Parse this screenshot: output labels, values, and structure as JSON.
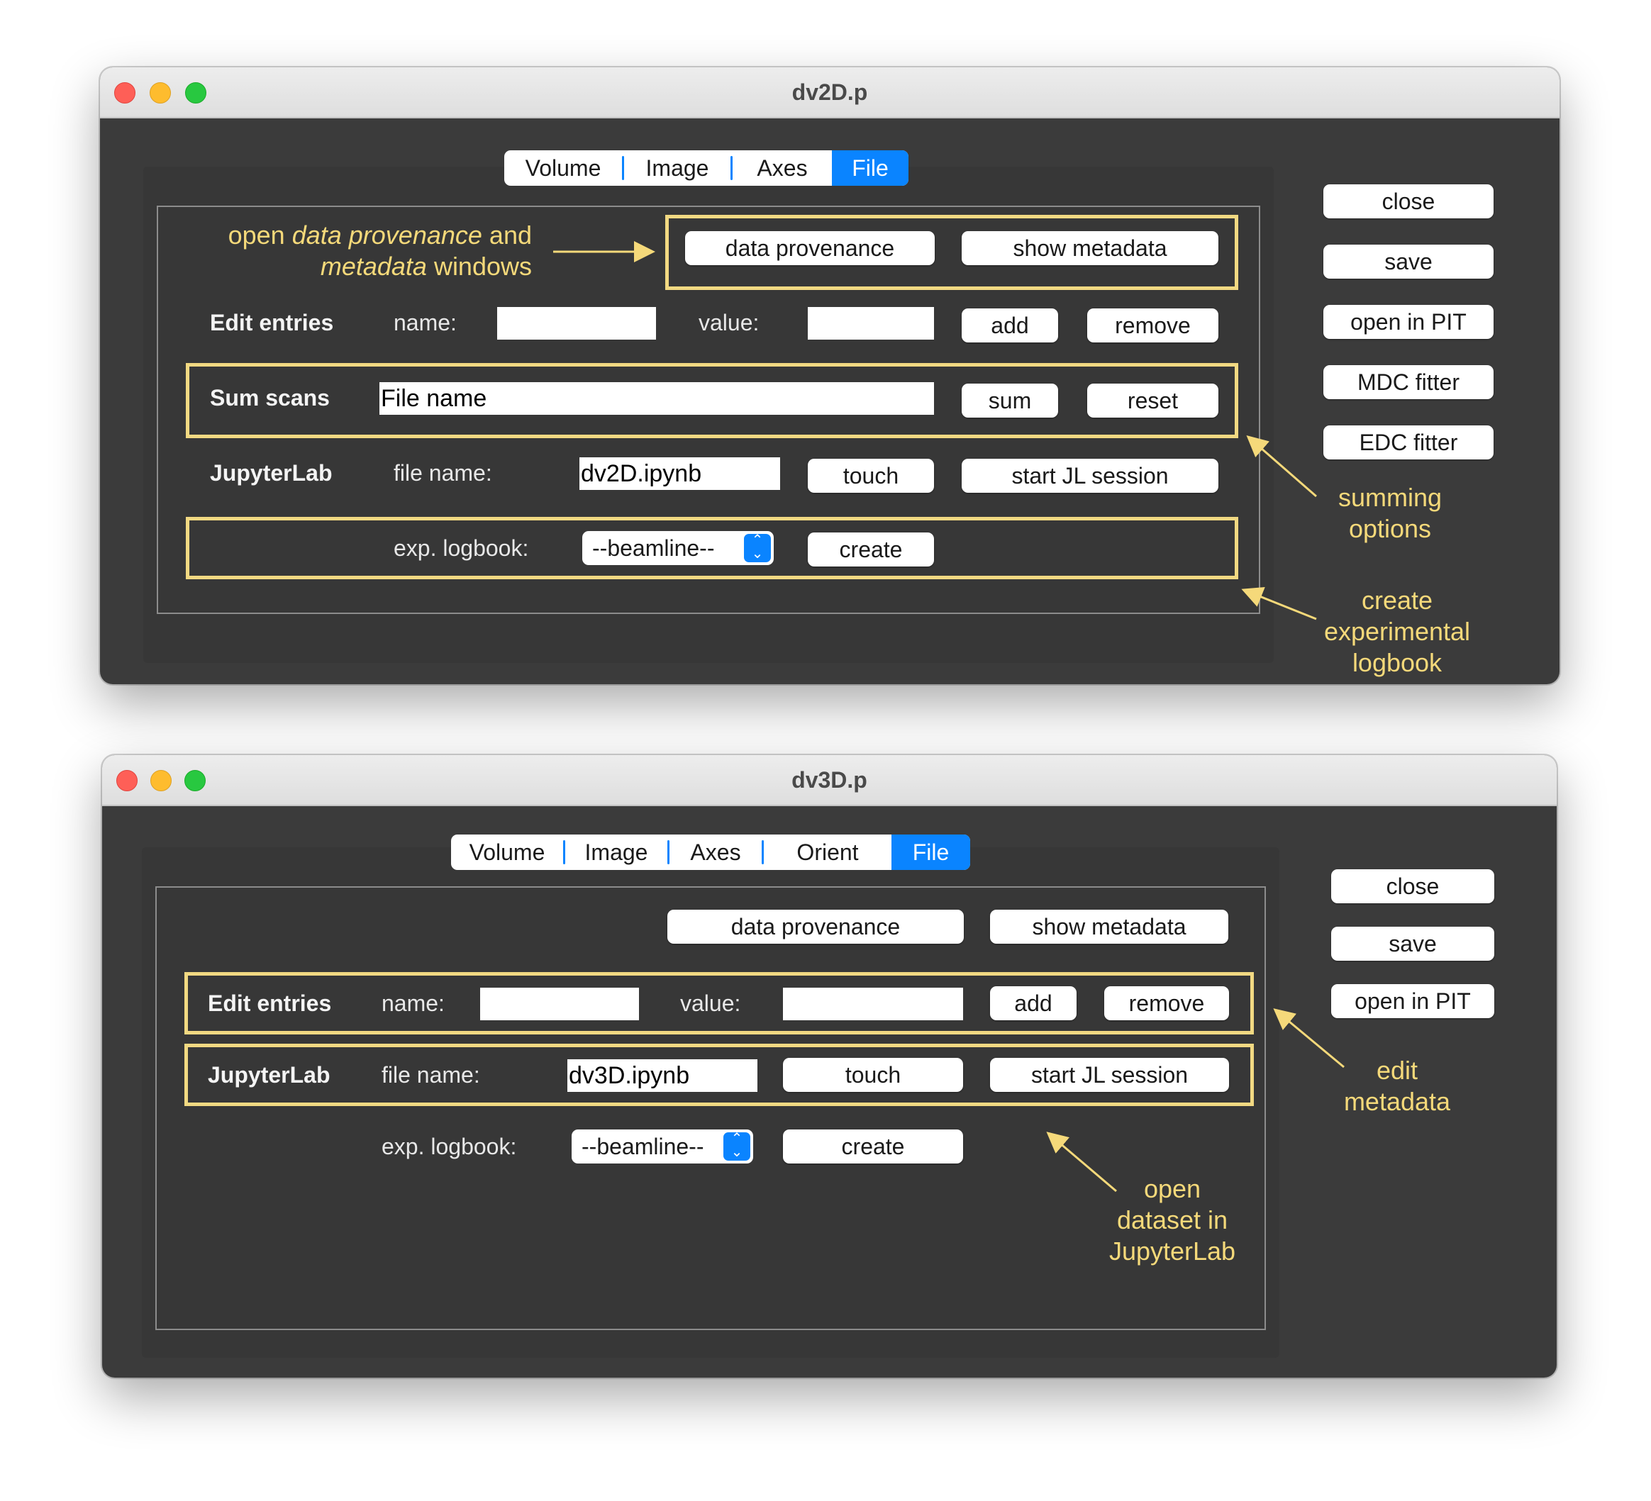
{
  "window1": {
    "title": "dv2D.p",
    "tabs": [
      "Volume",
      "Image",
      "Axes",
      "File"
    ],
    "data_provenance": "data provenance",
    "show_metadata": "show metadata",
    "edit_entries": "Edit entries",
    "name_label": "name:",
    "name_value": "",
    "value_label": "value:",
    "value_value": "",
    "add": "add",
    "remove": "remove",
    "sum_scans": "Sum scans",
    "sum_file_name": "File name",
    "sum": "sum",
    "reset": "reset",
    "jupyterlab": "JupyterLab",
    "file_name_label": "file name:",
    "file_name_value": "dv2D.ipynb",
    "touch": "touch",
    "start_jl": "start JL session",
    "logbook_label": "exp. logbook:",
    "logbook_value": "--beamline--",
    "create": "create",
    "side_buttons": [
      "close",
      "save",
      "open in PIT",
      "MDC fitter",
      "EDC fitter"
    ]
  },
  "window2": {
    "title": "dv3D.p",
    "tabs": [
      "Volume",
      "Image",
      "Axes",
      "Orient",
      "File"
    ],
    "data_provenance": "data provenance",
    "show_metadata": "show metadata",
    "edit_entries": "Edit entries",
    "name_label": "name:",
    "name_value": "",
    "value_label": "value:",
    "value_value": "",
    "add": "add",
    "remove": "remove",
    "jupyterlab": "JupyterLab",
    "file_name_label": "file name:",
    "file_name_value": "dv3D.ipynb",
    "touch": "touch",
    "start_jl": "start JL session",
    "logbook_label": "exp. logbook:",
    "logbook_value": "--beamline--",
    "create": "create",
    "side_buttons": [
      "close",
      "save",
      "open in PIT"
    ]
  },
  "annotations": {
    "open_windows_part1": "open ",
    "open_windows_em1": "data provenance",
    "open_windows_part2": " and",
    "open_windows_em2": "metadata",
    "open_windows_part3": " windows",
    "summing_options": [
      "summing",
      "options"
    ],
    "create_logbook": [
      "create",
      "experimental",
      "logbook"
    ],
    "edit_metadata": [
      "edit",
      "metadata"
    ],
    "open_jupyterlab": [
      "open",
      "dataset in",
      "JupyterLab"
    ]
  },
  "colors": {
    "annotation": "#f5d97a",
    "window_bg": "#3b3b3b",
    "accent_blue": "#0a84ff"
  }
}
